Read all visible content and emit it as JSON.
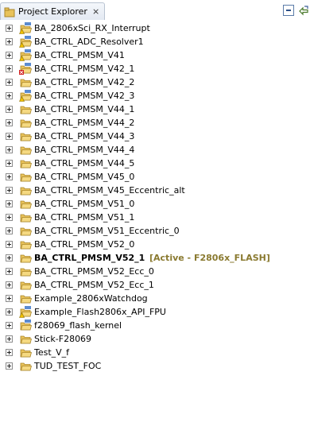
{
  "view": {
    "title": "Project Explorer",
    "close_glyph": "⨯",
    "toolbar": {
      "collapse_icon": "collapse-all-icon",
      "link_icon": "link-with-editor-icon"
    }
  },
  "projects": [
    {
      "name": "BA_2806xSci_RX_Interrupt",
      "overlay": "warning"
    },
    {
      "name": "BA_CTRL_ADC_Resolver1",
      "overlay": "warning"
    },
    {
      "name": "BA_CTRL_PMSM_V41",
      "overlay": "warning"
    },
    {
      "name": "BA_CTRL_PMSM_V42_1",
      "overlay": "error"
    },
    {
      "name": "BA_CTRL_PMSM_V42_2",
      "overlay": "none"
    },
    {
      "name": "BA_CTRL_PMSM_V42_3",
      "overlay": "warning"
    },
    {
      "name": "BA_CTRL_PMSM_V44_1",
      "overlay": "none"
    },
    {
      "name": "BA_CTRL_PMSM_V44_2",
      "overlay": "none"
    },
    {
      "name": "BA_CTRL_PMSM_V44_3",
      "overlay": "none"
    },
    {
      "name": "BA_CTRL_PMSM_V44_4",
      "overlay": "none"
    },
    {
      "name": "BA_CTRL_PMSM_V44_5",
      "overlay": "none"
    },
    {
      "name": "BA_CTRL_PMSM_V45_0",
      "overlay": "none"
    },
    {
      "name": "BA_CTRL_PMSM_V45_Eccentric_alt",
      "overlay": "none"
    },
    {
      "name": "BA_CTRL_PMSM_V51_0",
      "overlay": "none"
    },
    {
      "name": "BA_CTRL_PMSM_V51_1",
      "overlay": "none"
    },
    {
      "name": "BA_CTRL_PMSM_V51_Eccentric_0",
      "overlay": "none"
    },
    {
      "name": "BA_CTRL_PMSM_V52_0",
      "overlay": "none"
    },
    {
      "name": "BA_CTRL_PMSM_V52_1",
      "overlay": "none",
      "active": true,
      "active_label": "[Active - F2806x_FLASH]"
    },
    {
      "name": "BA_CTRL_PMSM_V52_Ecc_0",
      "overlay": "none"
    },
    {
      "name": "BA_CTRL_PMSM_V52_Ecc_1",
      "overlay": "none"
    },
    {
      "name": "Example_2806xWatchdog",
      "overlay": "none"
    },
    {
      "name": "Example_Flash2806x_API_FPU",
      "overlay": "warning"
    },
    {
      "name": "f28069_flash_kernel",
      "overlay": "ccs"
    },
    {
      "name": "Stick-F28069",
      "overlay": "none"
    },
    {
      "name": "Test_V_f",
      "overlay": "none"
    },
    {
      "name": "TUD_TEST_FOC",
      "overlay": "none"
    }
  ],
  "colors": {
    "active_tag": "#8a7a30",
    "folder": "#e8c25a",
    "ccs_badge": "#5b8bd0",
    "warning": "#f2c200",
    "error": "#d22222"
  }
}
